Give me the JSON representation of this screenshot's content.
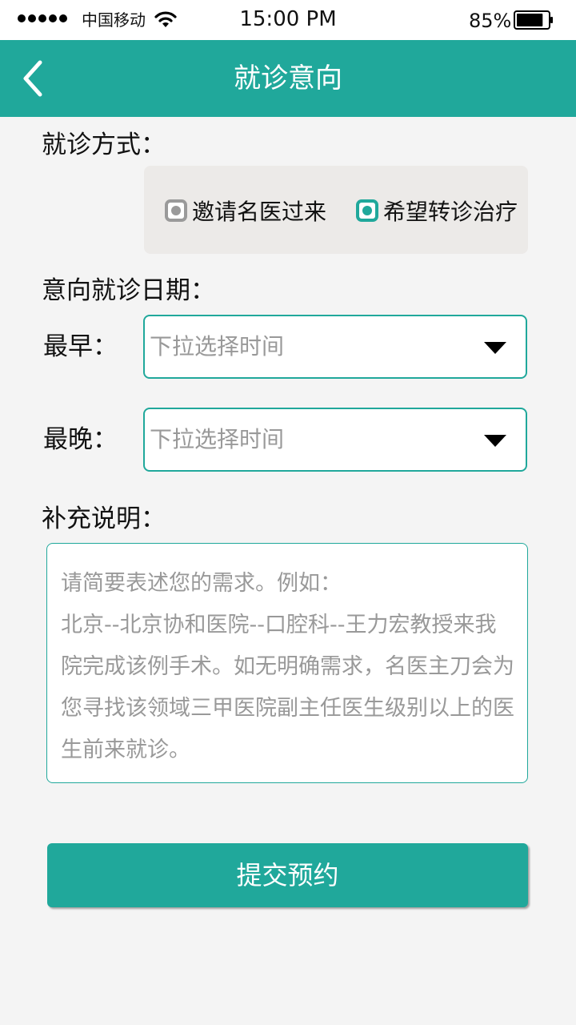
{
  "status_bar": {
    "carrier": "中国移动",
    "time": "15:00 PM",
    "battery": "85%",
    "battery_level": 0.85
  },
  "nav": {
    "title": "就诊意向"
  },
  "method": {
    "label": "就诊方式：",
    "options": [
      {
        "label": "邀请名医过来",
        "selected": false
      },
      {
        "label": "希望转诊治疗",
        "selected": true
      }
    ]
  },
  "dates": {
    "label": "意向就诊日期：",
    "earliest_label": "最早：",
    "latest_label": "最晚：",
    "earliest_placeholder": "下拉选择时间",
    "latest_placeholder": "下拉选择时间"
  },
  "note": {
    "label": "补充说明：",
    "placeholder": "请简要表述您的需求。例如：\n北京--北京协和医院--口腔科--王力宏教授来我院完成该例手术。如无明确需求，名医主刀会为您寻找该领域三甲医院副主任医生级别以上的医生前来就诊。"
  },
  "submit_label": "提交预约",
  "colors": {
    "accent": "#20a89b",
    "background": "#f4f4f4",
    "option_box": "#eceae8",
    "placeholder": "#999999"
  }
}
